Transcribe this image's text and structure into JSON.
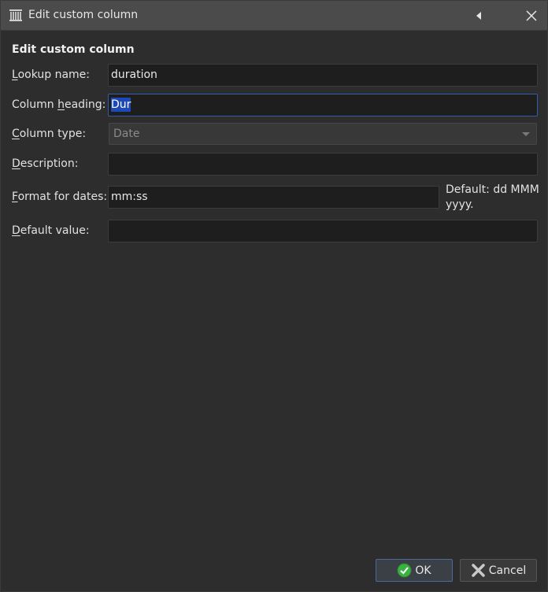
{
  "window": {
    "title": "Edit custom column",
    "title_icon": "library-icon",
    "back_icon": "triangle-left-icon",
    "close_icon": "close-icon"
  },
  "form": {
    "section_title": "Edit custom column",
    "lookup_name": {
      "label_pre": "",
      "label_key": "L",
      "label_post": "ookup name:",
      "value": "duration"
    },
    "column_heading": {
      "label_pre": "Column ",
      "label_key": "h",
      "label_post": "eading:",
      "value": "Dur"
    },
    "column_type": {
      "label_pre": "",
      "label_key": "C",
      "label_post": "olumn type:",
      "value": "Date"
    },
    "description": {
      "label_pre": "",
      "label_key": "D",
      "label_post": "escription:",
      "value": ""
    },
    "format_for_dates": {
      "label_pre": "",
      "label_key": "F",
      "label_post": "ormat for dates:",
      "value": "mm:ss",
      "hint": "Default: dd MMM yyyy."
    },
    "default_value": {
      "label_pre": "",
      "label_key": "D",
      "label_post": "efault value:",
      "value": ""
    }
  },
  "buttons": {
    "ok_label": "OK",
    "ok_icon": "check-circle-icon",
    "cancel_label": "Cancel",
    "cancel_icon": "x-icon"
  },
  "colors": {
    "accent": "#2f5fa8",
    "selection": "#1c48b8",
    "ok_icon": "#3cb043"
  }
}
